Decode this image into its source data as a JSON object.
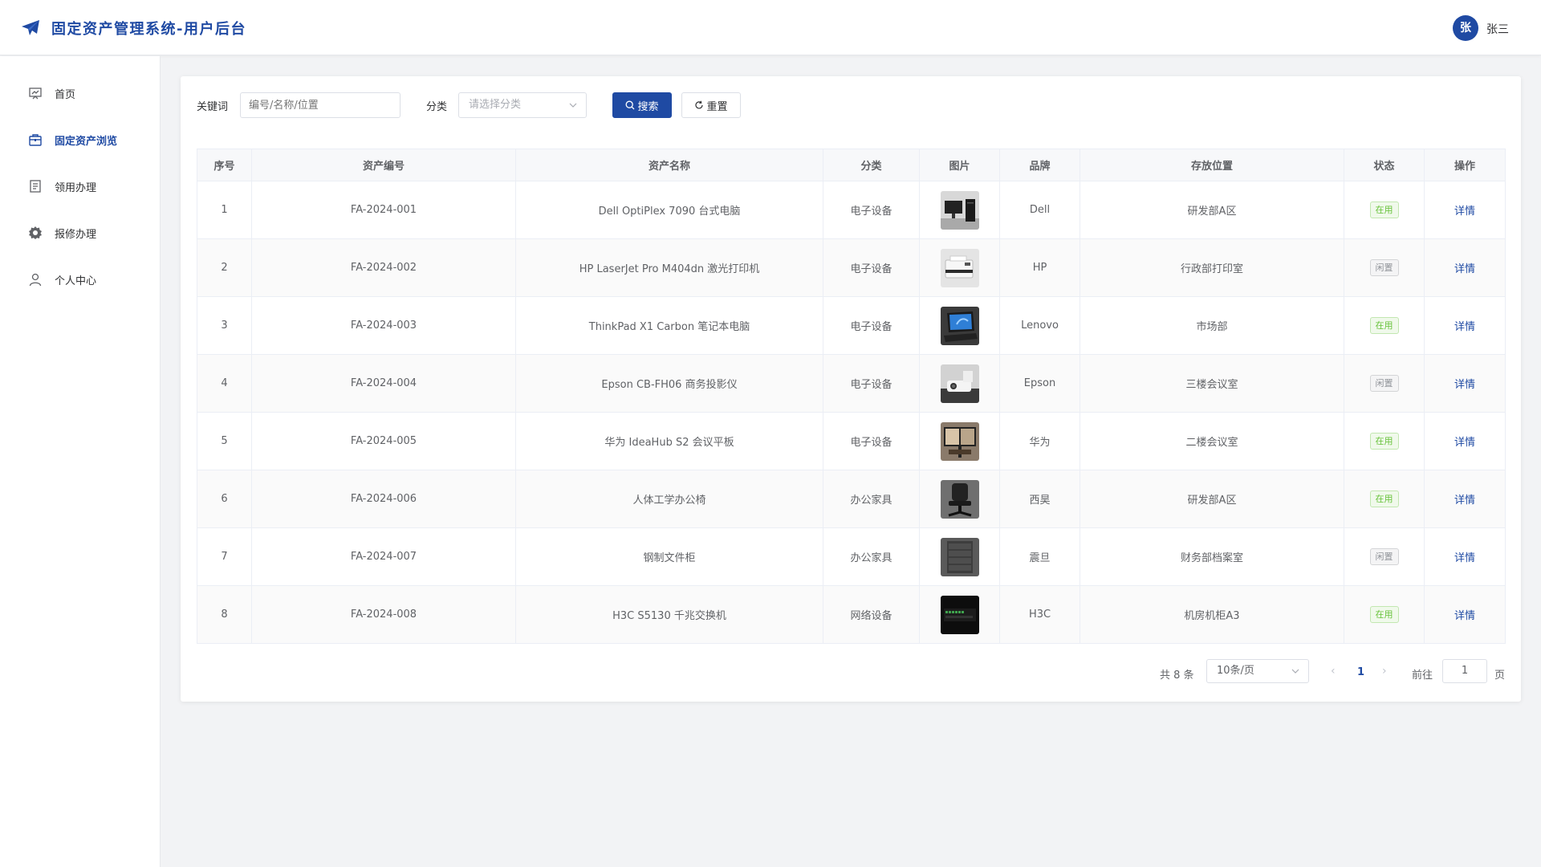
{
  "header": {
    "app_title": "固定资产管理系统-用户后台",
    "avatar_initial": "张",
    "username": "张三",
    "brand_color": "#1f4aa3"
  },
  "sidebar": {
    "items": [
      {
        "label": "首页",
        "icon": "dashboard-icon",
        "active": false
      },
      {
        "label": "固定资产浏览",
        "icon": "briefcase-icon",
        "active": true
      },
      {
        "label": "领用办理",
        "icon": "document-icon",
        "active": false
      },
      {
        "label": "报修办理",
        "icon": "gear-icon",
        "active": false
      },
      {
        "label": "个人中心",
        "icon": "user-icon",
        "active": false
      }
    ]
  },
  "filters": {
    "keyword_label": "关键词",
    "keyword_placeholder": "编号/名称/位置",
    "keyword_value": "",
    "category_label": "分类",
    "category_placeholder": "请选择分类",
    "search_button": "搜索",
    "reset_button": "重置"
  },
  "table": {
    "columns": [
      "序号",
      "资产编号",
      "资产名称",
      "分类",
      "图片",
      "品牌",
      "存放位置",
      "状态",
      "操作"
    ],
    "rows": [
      {
        "index": "1",
        "code": "FA-2024-001",
        "name": "Dell OptiPlex 7090 台式电脑",
        "category": "电子设备",
        "image": "desktop-pc",
        "brand": "Dell",
        "location": "研发部A区",
        "status": "在用",
        "action": "详情"
      },
      {
        "index": "2",
        "code": "FA-2024-002",
        "name": "HP LaserJet Pro M404dn 激光打印机",
        "category": "电子设备",
        "image": "laser-printer",
        "brand": "HP",
        "location": "行政部打印室",
        "status": "闲置",
        "action": "详情"
      },
      {
        "index": "3",
        "code": "FA-2024-003",
        "name": "ThinkPad X1 Carbon 笔记本电脑",
        "category": "电子设备",
        "image": "laptop",
        "brand": "Lenovo",
        "location": "市场部",
        "status": "在用",
        "action": "详情"
      },
      {
        "index": "4",
        "code": "FA-2024-004",
        "name": "Epson CB-FH06 商务投影仪",
        "category": "电子设备",
        "image": "projector",
        "brand": "Epson",
        "location": "三楼会议室",
        "status": "闲置",
        "action": "详情"
      },
      {
        "index": "5",
        "code": "FA-2024-005",
        "name": "华为 IdeaHub S2 会议平板",
        "category": "电子设备",
        "image": "conference-panel",
        "brand": "华为",
        "location": "二楼会议室",
        "status": "在用",
        "action": "详情"
      },
      {
        "index": "6",
        "code": "FA-2024-006",
        "name": "人体工学办公椅",
        "category": "办公家具",
        "image": "office-chair",
        "brand": "西昊",
        "location": "研发部A区",
        "status": "在用",
        "action": "详情"
      },
      {
        "index": "7",
        "code": "FA-2024-007",
        "name": "钢制文件柜",
        "category": "办公家具",
        "image": "file-cabinet",
        "brand": "震旦",
        "location": "财务部档案室",
        "status": "闲置",
        "action": "详情"
      },
      {
        "index": "8",
        "code": "FA-2024-008",
        "name": "H3C S5130 千兆交换机",
        "category": "网络设备",
        "image": "network-switch",
        "brand": "H3C",
        "location": "机房机柜A3",
        "status": "在用",
        "action": "详情"
      }
    ],
    "status_colors": {
      "在用": "#67c23a",
      "闲置": "#909399"
    }
  },
  "pagination": {
    "total_text": "共 8 条",
    "page_size": "10条/页",
    "current_page": "1",
    "goto_label": "前往",
    "goto_value": "1",
    "page_unit": "页"
  }
}
